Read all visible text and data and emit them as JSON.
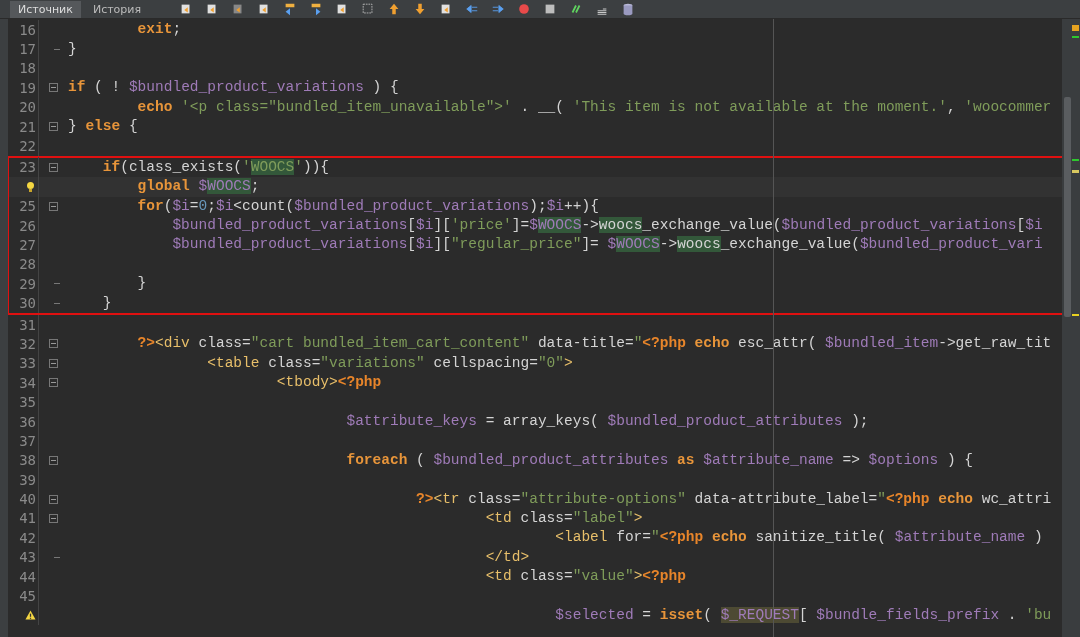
{
  "tabs": [
    {
      "label": "Источник",
      "selected": true
    },
    {
      "label": "История",
      "selected": false
    }
  ],
  "blocks": [
    {
      "lines": [
        {
          "number": "16",
          "tokens": [
            {
              "kind": "keyword",
              "text": "        exit"
            },
            {
              "kind": "plain",
              "text": ";"
            }
          ]
        },
        {
          "number": "17",
          "fold_end": true,
          "tokens": [
            {
              "kind": "plain",
              "text": "}"
            }
          ]
        },
        {
          "number": "18"
        },
        {
          "number": "19",
          "fold_start": true,
          "tokens": [
            {
              "kind": "keyword",
              "text": "if"
            },
            {
              "kind": "plain",
              "text": " ( ! "
            },
            {
              "kind": "var",
              "text": "$bundled_product_variations"
            },
            {
              "kind": "plain",
              "text": " ) {"
            }
          ]
        },
        {
          "number": "20",
          "tokens": [
            {
              "kind": "keyword",
              "text": "        echo"
            },
            {
              "kind": "string",
              "text": " '<p class=\"bundled_item_unavailable\">'"
            },
            {
              "kind": "plain",
              "text": " . __( "
            },
            {
              "kind": "string",
              "text": "'This item is not available at the moment.'"
            },
            {
              "kind": "plain",
              "text": ", "
            },
            {
              "kind": "string",
              "text": "'woocommer"
            }
          ]
        },
        {
          "number": "21",
          "fold_start": true,
          "tokens": [
            {
              "kind": "plain",
              "text": "} "
            },
            {
              "kind": "keyword",
              "text": "else"
            },
            {
              "kind": "plain",
              "text": " {"
            }
          ]
        },
        {
          "number": "22"
        }
      ]
    },
    {
      "boxed": true,
      "lines": [
        {
          "number": "23",
          "fold_start": true,
          "tokens": [
            {
              "kind": "keyword",
              "text": "    if"
            },
            {
              "kind": "plain",
              "text": "(class_exists("
            },
            {
              "kind": "string",
              "text": "'"
            },
            {
              "kind": "string",
              "text": "WOOCS",
              "occurrence": true
            },
            {
              "kind": "string",
              "text": "'"
            },
            {
              "kind": "plain",
              "text": ")){"
            }
          ]
        },
        {
          "hint": true,
          "current": true,
          "tokens": [
            {
              "kind": "keyword",
              "text": "        global"
            },
            {
              "kind": "var",
              "text": " $"
            },
            {
              "kind": "var",
              "text": "WOOCS",
              "occurrence": true
            },
            {
              "kind": "plain",
              "text": ";"
            }
          ]
        },
        {
          "number": "25",
          "fold_start": true,
          "tokens": [
            {
              "kind": "keyword",
              "text": "        for"
            },
            {
              "kind": "plain",
              "text": "("
            },
            {
              "kind": "var",
              "text": "$i"
            },
            {
              "kind": "plain",
              "text": "="
            },
            {
              "kind": "number",
              "text": "0"
            },
            {
              "kind": "plain",
              "text": ";"
            },
            {
              "kind": "var",
              "text": "$i"
            },
            {
              "kind": "plain",
              "text": "<count("
            },
            {
              "kind": "var",
              "text": "$bundled_product_variations"
            },
            {
              "kind": "plain",
              "text": ");"
            },
            {
              "kind": "var",
              "text": "$i"
            },
            {
              "kind": "plain",
              "text": "++){"
            }
          ]
        },
        {
          "number": "26",
          "tokens": [
            {
              "kind": "var",
              "text": "            $bundled_product_variations"
            },
            {
              "kind": "plain",
              "text": "["
            },
            {
              "kind": "var",
              "text": "$i"
            },
            {
              "kind": "plain",
              "text": "]["
            },
            {
              "kind": "string",
              "text": "'price'"
            },
            {
              "kind": "plain",
              "text": "]="
            },
            {
              "kind": "var",
              "text": "$"
            },
            {
              "kind": "var",
              "text": "WOOCS",
              "occurrence": true
            },
            {
              "kind": "plain",
              "text": "->"
            },
            {
              "kind": "plain",
              "text": "woocs",
              "occurrence": true
            },
            {
              "kind": "plain",
              "text": "_exchange_value("
            },
            {
              "kind": "var",
              "text": "$bundled_product_variations"
            },
            {
              "kind": "plain",
              "text": "["
            },
            {
              "kind": "var",
              "text": "$i"
            }
          ]
        },
        {
          "number": "27",
          "tokens": [
            {
              "kind": "var",
              "text": "            $bundled_product_variations"
            },
            {
              "kind": "plain",
              "text": "["
            },
            {
              "kind": "var",
              "text": "$i"
            },
            {
              "kind": "plain",
              "text": "]["
            },
            {
              "kind": "string",
              "text": "\"regular_price\""
            },
            {
              "kind": "plain",
              "text": "]= "
            },
            {
              "kind": "var",
              "text": "$"
            },
            {
              "kind": "var",
              "text": "WOOCS",
              "occurrence": true
            },
            {
              "kind": "plain",
              "text": "->"
            },
            {
              "kind": "plain",
              "text": "woocs",
              "occurrence": true
            },
            {
              "kind": "plain",
              "text": "_exchange_value("
            },
            {
              "kind": "var",
              "text": "$bundled_product_vari"
            }
          ]
        },
        {
          "number": "28"
        },
        {
          "number": "29",
          "fold_end": true,
          "tokens": [
            {
              "kind": "plain",
              "text": "        }"
            }
          ]
        },
        {
          "number": "30",
          "fold_end": true,
          "tokens": [
            {
              "kind": "plain",
              "text": "    }"
            }
          ]
        }
      ]
    },
    {
      "lines": [
        {
          "number": "31"
        },
        {
          "number": "32",
          "fold_start": true,
          "tokens": [
            {
              "kind": "php",
              "text": "        ?>"
            },
            {
              "kind": "tag",
              "text": "<div"
            },
            {
              "kind": "plain",
              "text": " class="
            },
            {
              "kind": "string",
              "text": "\"cart bundled_item_cart_content\""
            },
            {
              "kind": "plain",
              "text": " data-title="
            },
            {
              "kind": "string",
              "text": "\""
            },
            {
              "kind": "php",
              "text": "<?php"
            },
            {
              "kind": "keyword",
              "text": " echo"
            },
            {
              "kind": "plain",
              "text": " esc_attr( "
            },
            {
              "kind": "var",
              "text": "$bundled_item"
            },
            {
              "kind": "plain",
              "text": "->get_raw_tit"
            }
          ]
        },
        {
          "number": "33",
          "fold_start": true,
          "tokens": [
            {
              "kind": "tag",
              "text": "                <table"
            },
            {
              "kind": "plain",
              "text": " class="
            },
            {
              "kind": "string",
              "text": "\"variations\""
            },
            {
              "kind": "plain",
              "text": " cellspacing="
            },
            {
              "kind": "string",
              "text": "\"0\""
            },
            {
              "kind": "tag",
              "text": ">"
            }
          ]
        },
        {
          "number": "34",
          "fold_start": true,
          "tokens": [
            {
              "kind": "tag",
              "text": "                        <tbody>"
            },
            {
              "kind": "php",
              "text": "<?php"
            }
          ]
        },
        {
          "number": "35"
        },
        {
          "number": "36",
          "tokens": [
            {
              "kind": "var",
              "text": "                                $attribute_keys"
            },
            {
              "kind": "plain",
              "text": " = array_keys( "
            },
            {
              "kind": "var",
              "text": "$bundled_product_attributes"
            },
            {
              "kind": "plain",
              "text": " );"
            }
          ]
        },
        {
          "number": "37"
        },
        {
          "number": "38",
          "fold_start": true,
          "tokens": [
            {
              "kind": "keyword",
              "text": "                                foreach"
            },
            {
              "kind": "plain",
              "text": " ( "
            },
            {
              "kind": "var",
              "text": "$bundled_product_attributes"
            },
            {
              "kind": "keyword",
              "text": " as"
            },
            {
              "kind": "var",
              "text": " $attribute_name"
            },
            {
              "kind": "plain",
              "text": " => "
            },
            {
              "kind": "var",
              "text": "$options"
            },
            {
              "kind": "plain",
              "text": " ) {"
            }
          ]
        },
        {
          "number": "39"
        },
        {
          "number": "40",
          "fold_start": true,
          "tokens": [
            {
              "kind": "php",
              "text": "                                        ?>"
            },
            {
              "kind": "tag",
              "text": "<tr"
            },
            {
              "kind": "plain",
              "text": " class="
            },
            {
              "kind": "string",
              "text": "\"attribute-options\""
            },
            {
              "kind": "plain",
              "text": " data-attribute_label="
            },
            {
              "kind": "string",
              "text": "\""
            },
            {
              "kind": "php",
              "text": "<?php"
            },
            {
              "kind": "keyword",
              "text": " echo"
            },
            {
              "kind": "plain",
              "text": " wc_attri"
            }
          ]
        },
        {
          "number": "41",
          "fold_start": true,
          "tokens": [
            {
              "kind": "tag",
              "text": "                                                <td"
            },
            {
              "kind": "plain",
              "text": " class="
            },
            {
              "kind": "string",
              "text": "\"label\""
            },
            {
              "kind": "tag",
              "text": ">"
            }
          ]
        },
        {
          "number": "42",
          "tokens": [
            {
              "kind": "tag",
              "text": "                                                        <label"
            },
            {
              "kind": "plain",
              "text": " for="
            },
            {
              "kind": "string",
              "text": "\""
            },
            {
              "kind": "php",
              "text": "<?php"
            },
            {
              "kind": "keyword",
              "text": " echo"
            },
            {
              "kind": "plain",
              "text": " sanitize_title( "
            },
            {
              "kind": "var",
              "text": "$attribute_name"
            },
            {
              "kind": "plain",
              "text": " )"
            }
          ]
        },
        {
          "number": "43",
          "fold_end": true,
          "tokens": [
            {
              "kind": "tag",
              "text": "                                                </td>"
            }
          ]
        },
        {
          "number": "44",
          "tokens": [
            {
              "kind": "tag",
              "text": "                                                <td"
            },
            {
              "kind": "plain",
              "text": " class="
            },
            {
              "kind": "string",
              "text": "\"value\""
            },
            {
              "kind": "tag",
              "text": ">"
            },
            {
              "kind": "php",
              "text": "<?php"
            }
          ]
        },
        {
          "number": "45"
        },
        {
          "warning": true,
          "tokens": [
            {
              "kind": "var",
              "text": "                                                        $selected"
            },
            {
              "kind": "plain",
              "text": " = "
            },
            {
              "kind": "keyword",
              "text": "isset"
            },
            {
              "kind": "plain",
              "text": "( "
            },
            {
              "kind": "var",
              "text": "$_REQUEST",
              "superglobal": true
            },
            {
              "kind": "plain",
              "text": "[ "
            },
            {
              "kind": "var",
              "text": "$bundle_fields_prefix"
            },
            {
              "kind": "plain",
              "text": " . "
            },
            {
              "kind": "string",
              "text": "'bu"
            }
          ]
        }
      ]
    }
  ]
}
